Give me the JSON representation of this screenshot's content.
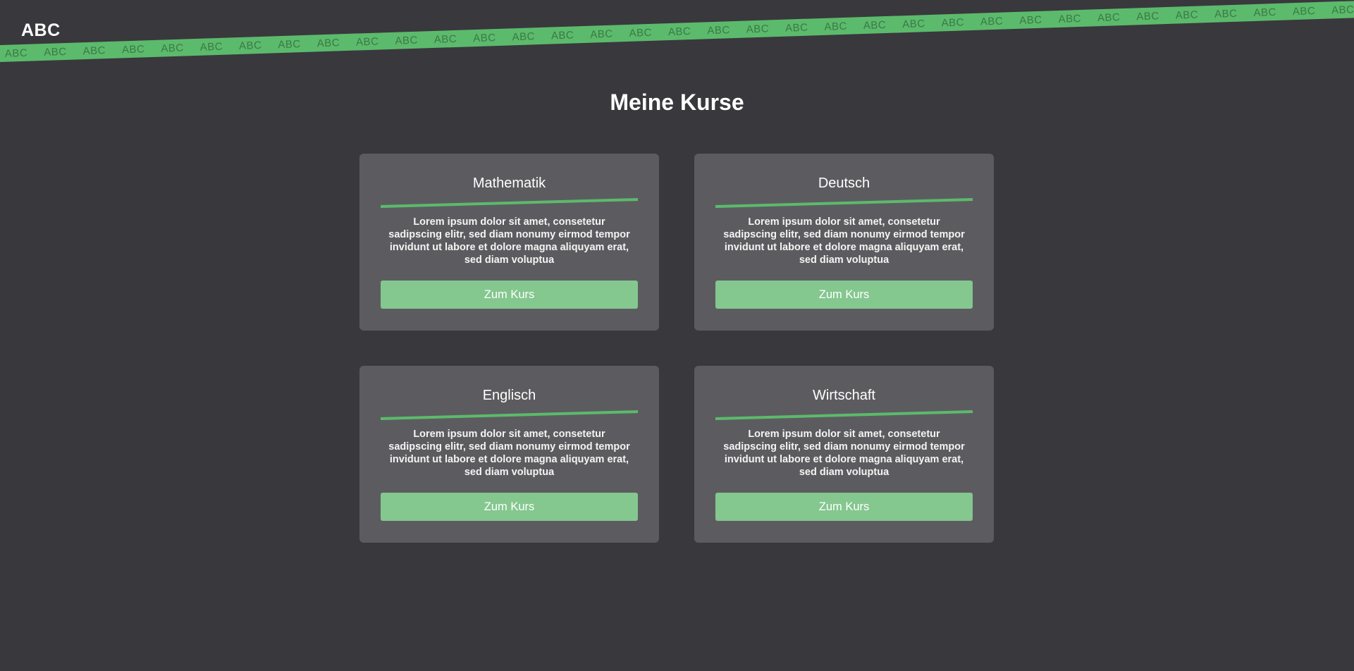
{
  "header": {
    "logo": "ABC"
  },
  "banner": {
    "text": "ABC",
    "repeat": 36,
    "color": "#5cba6c",
    "text_color": "#3a7a45"
  },
  "main": {
    "title": "Meine Kurse",
    "accent_color": "#5cba6c",
    "button_color": "#84c78f",
    "courses": [
      {
        "title": "Mathematik",
        "description": "Lorem ipsum dolor sit amet, consetetur sadipscing elitr, sed diam nonumy eirmod tempor invidunt ut labore et dolore magna aliquyam erat, sed diam voluptua",
        "button_label": "Zum Kurs"
      },
      {
        "title": "Deutsch",
        "description": "Lorem ipsum dolor sit amet, consetetur sadipscing elitr, sed diam nonumy eirmod tempor invidunt ut labore et dolore magna aliquyam erat, sed diam voluptua",
        "button_label": "Zum Kurs"
      },
      {
        "title": "Englisch",
        "description": "Lorem ipsum dolor sit amet, consetetur sadipscing elitr, sed diam nonumy eirmod tempor invidunt ut labore et dolore magna aliquyam erat, sed diam voluptua",
        "button_label": "Zum Kurs"
      },
      {
        "title": "Wirtschaft",
        "description": "Lorem ipsum dolor sit amet, consetetur sadipscing elitr, sed diam nonumy eirmod tempor invidunt ut labore et dolore magna aliquyam erat, sed diam voluptua",
        "button_label": "Zum Kurs"
      }
    ]
  }
}
